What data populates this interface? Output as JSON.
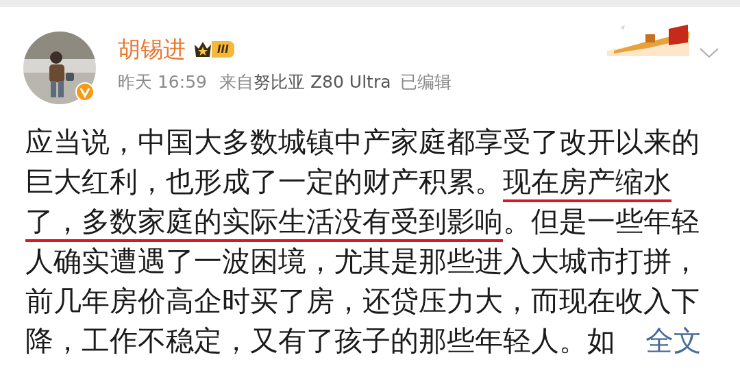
{
  "author": {
    "name": "胡锡进",
    "level": "III",
    "verified": true
  },
  "meta": {
    "time": "昨天 16:59",
    "source_prefix": "来自",
    "source": "努比亚 Z80 Ultra",
    "edited": "已编辑"
  },
  "body": {
    "lines": [
      [
        {
          "text": "应当说，中国大多数城镇中产家庭都享受了改开以来的",
          "underlined": false
        }
      ],
      [
        {
          "text": "巨大红利，也形成了一定的财产积累。",
          "underlined": false
        },
        {
          "text": "现在房产缩水",
          "underlined": true
        }
      ],
      [
        {
          "text": "了，多数家庭的实际生活没有受到影响",
          "underlined": true
        },
        {
          "text": "。但是一些年轻",
          "underlined": false
        }
      ],
      [
        {
          "text": "人确实遭遇了一波困境，尤其是那些进入大城市打拼，",
          "underlined": false
        }
      ],
      [
        {
          "text": "前几年房价高企时买了房，还贷压力大，而现在收入下",
          "underlined": false
        }
      ],
      [
        {
          "text": "降，工作不稳定，又有了孩子的那些年轻人。如",
          "underlined": false
        }
      ]
    ],
    "more_link": "全文"
  }
}
